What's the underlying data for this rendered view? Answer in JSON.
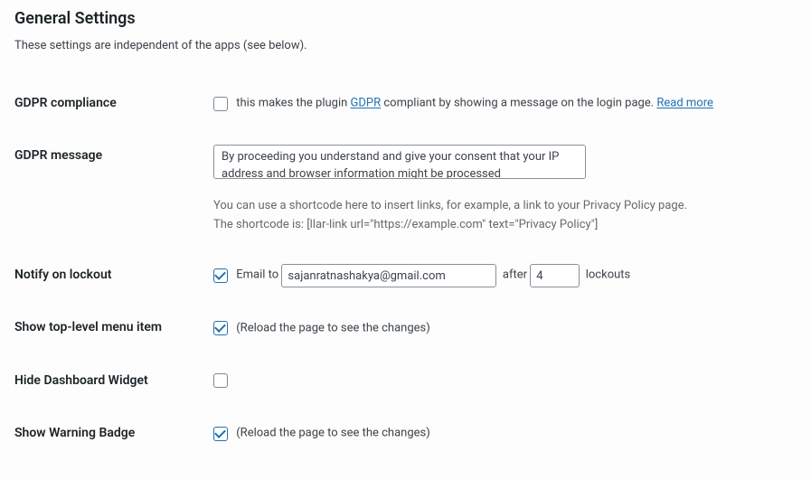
{
  "page": {
    "title": "General Settings",
    "subline": "These settings are independent of the apps (see below)."
  },
  "gdpr_compliance": {
    "label": "GDPR compliance",
    "checked": false,
    "text_before": "this makes the plugin ",
    "link1_text": "GDPR",
    "text_after": " compliant by showing a message on the login page. ",
    "readmore": "Read more"
  },
  "gdpr_message": {
    "label": "GDPR message",
    "value": "By proceeding you understand and give your consent that your IP address and browser information might be processed",
    "help_line1": "You can use a shortcode here to insert links, for example, a link to your Privacy Policy page.",
    "help_line2": "The shortcode is: [llar-link url=\"https://example.com\" text=\"Privacy Policy\"]"
  },
  "notify": {
    "label": "Notify on lockout",
    "checked": true,
    "email_to_text": "Email to",
    "email_value": "sajanratnashakya@gmail.com",
    "after_text": "after",
    "count_value": "4",
    "lockouts_text": "lockouts"
  },
  "show_menu": {
    "label": "Show top-level menu item",
    "checked": true,
    "hint": "(Reload the page to see the changes)"
  },
  "hide_widget": {
    "label": "Hide Dashboard Widget",
    "checked": false
  },
  "show_badge": {
    "label": "Show Warning Badge",
    "checked": true,
    "hint": "(Reload the page to see the changes)"
  }
}
